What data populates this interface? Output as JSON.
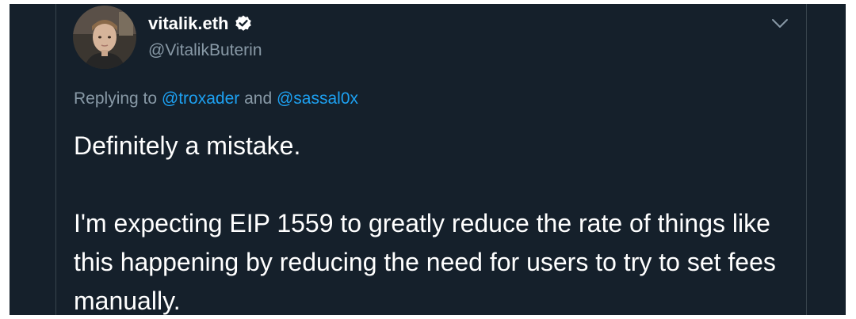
{
  "author": {
    "display_name": "vitalik.eth",
    "handle": "@VitalikButerin",
    "verified": true
  },
  "icons": {
    "avatar": "profile-photo",
    "verified": "verified-badge-icon",
    "more": "chevron-down-icon"
  },
  "reply": {
    "prefix": "Replying to ",
    "mentions": [
      "@troxader",
      "@sassal0x"
    ],
    "joiner": " and "
  },
  "tweet": {
    "paragraphs": [
      "Definitely a mistake.",
      "I'm expecting EIP 1559 to greatly reduce the rate of things like this happening by reducing the need for users to try to set fees manually."
    ]
  },
  "colors": {
    "background": "#15202b",
    "text": "#ffffff",
    "secondary": "#8899a6",
    "link": "#1da1f2",
    "divider": "#38444d"
  }
}
